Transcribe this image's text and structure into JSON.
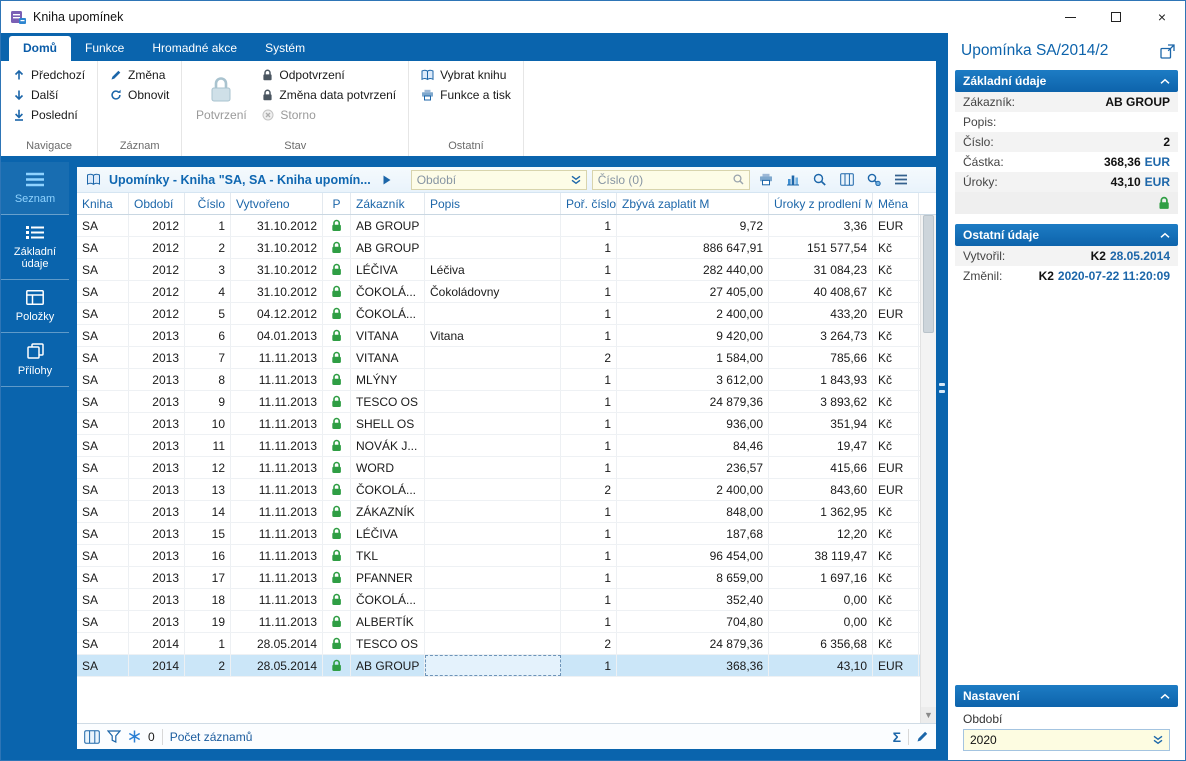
{
  "window": {
    "title": "Kniha upomínek",
    "controls": {
      "minimize": "–",
      "maximize": "",
      "close": "×"
    }
  },
  "tabs": [
    {
      "label": "Domů",
      "active": true
    },
    {
      "label": "Funkce",
      "active": false
    },
    {
      "label": "Hromadné akce",
      "active": false
    },
    {
      "label": "Systém",
      "active": false
    }
  ],
  "ribbon": {
    "navigace": {
      "label": "Navigace",
      "prev": "Předchozí",
      "next": "Další",
      "last": "Poslední"
    },
    "zaznam": {
      "label": "Záznam",
      "change": "Změna",
      "refresh": "Obnovit"
    },
    "stav": {
      "label": "Stav",
      "confirm": "Potvrzení",
      "unconfirm": "Odpotvrzení",
      "change_date": "Změna data potvrzení",
      "cancel": "Storno"
    },
    "ostatni": {
      "label": "Ostatní",
      "select_book": "Vybrat knihu",
      "functions_print": "Funkce a tisk"
    }
  },
  "sidebar": [
    {
      "label": "Seznam",
      "active": true
    },
    {
      "label": "Základní údaje",
      "active": false
    },
    {
      "label": "Položky",
      "active": false
    },
    {
      "label": "Přílohy",
      "active": false
    }
  ],
  "browser": {
    "title": "Upomínky - Kniha \"SA, SA - Kniha upomín...",
    "period_filter": "Období",
    "number_filter": "Číslo (0)",
    "columns": [
      "Kniha",
      "Období",
      "Číslo",
      "Vytvořeno",
      "P",
      "Zákazník",
      "Popis",
      "Poř. číslo",
      "Zbývá zaplatit M",
      "Úroky z prodlení M",
      "Měna"
    ],
    "selected_index": 20,
    "rows": [
      [
        "SA",
        "2012",
        "1",
        "31.10.2012",
        "lock",
        "AB GROUP",
        "",
        "1",
        "9,72",
        "3,36",
        "EUR"
      ],
      [
        "SA",
        "2012",
        "2",
        "31.10.2012",
        "lock",
        "AB GROUP",
        "",
        "1",
        "886 647,91",
        "151 577,54",
        "Kč"
      ],
      [
        "SA",
        "2012",
        "3",
        "31.10.2012",
        "lock",
        "LÉČIVA",
        "Léčiva",
        "1",
        "282 440,00",
        "31 084,23",
        "Kč"
      ],
      [
        "SA",
        "2012",
        "4",
        "31.10.2012",
        "lock",
        "ČOKOLÁ...",
        "Čokoládovny",
        "1",
        "27 405,00",
        "40 408,67",
        "Kč"
      ],
      [
        "SA",
        "2012",
        "5",
        "04.12.2012",
        "lock",
        "ČOKOLÁ...",
        "",
        "1",
        "2 400,00",
        "433,20",
        "EUR"
      ],
      [
        "SA",
        "2013",
        "6",
        "04.01.2013",
        "lock",
        "VITANA",
        "Vitana",
        "1",
        "9 420,00",
        "3 264,73",
        "Kč"
      ],
      [
        "SA",
        "2013",
        "7",
        "11.11.2013",
        "lock",
        "VITANA",
        "",
        "2",
        "1 584,00",
        "785,66",
        "Kč"
      ],
      [
        "SA",
        "2013",
        "8",
        "11.11.2013",
        "lock",
        "MLÝNY",
        "",
        "1",
        "3 612,00",
        "1 843,93",
        "Kč"
      ],
      [
        "SA",
        "2013",
        "9",
        "11.11.2013",
        "lock",
        "TESCO OS",
        "",
        "1",
        "24 879,36",
        "3 893,62",
        "Kč"
      ],
      [
        "SA",
        "2013",
        "10",
        "11.11.2013",
        "lock",
        "SHELL OS",
        "",
        "1",
        "936,00",
        "351,94",
        "Kč"
      ],
      [
        "SA",
        "2013",
        "11",
        "11.11.2013",
        "lock",
        "NOVÁK J...",
        "",
        "1",
        "84,46",
        "19,47",
        "Kč"
      ],
      [
        "SA",
        "2013",
        "12",
        "11.11.2013",
        "lock",
        "WORD",
        "",
        "1",
        "236,57",
        "415,66",
        "EUR"
      ],
      [
        "SA",
        "2013",
        "13",
        "11.11.2013",
        "lock",
        "ČOKOLÁ...",
        "",
        "2",
        "2 400,00",
        "843,60",
        "EUR"
      ],
      [
        "SA",
        "2013",
        "14",
        "11.11.2013",
        "lock",
        "ZÁKAZNÍK",
        "",
        "1",
        "848,00",
        "1 362,95",
        "Kč"
      ],
      [
        "SA",
        "2013",
        "15",
        "11.11.2013",
        "lock",
        "LÉČIVA",
        "",
        "1",
        "187,68",
        "12,20",
        "Kč"
      ],
      [
        "SA",
        "2013",
        "16",
        "11.11.2013",
        "lock",
        "TKL",
        "",
        "1",
        "96 454,00",
        "38 119,47",
        "Kč"
      ],
      [
        "SA",
        "2013",
        "17",
        "11.11.2013",
        "lock",
        "PFANNER",
        "",
        "1",
        "8 659,00",
        "1 697,16",
        "Kč"
      ],
      [
        "SA",
        "2013",
        "18",
        "11.11.2013",
        "lock",
        "ČOKOLÁ...",
        "",
        "1",
        "352,40",
        "0,00",
        "Kč"
      ],
      [
        "SA",
        "2013",
        "19",
        "11.11.2013",
        "lock",
        "ALBERTÍK",
        "",
        "1",
        "704,80",
        "0,00",
        "Kč"
      ],
      [
        "SA",
        "2014",
        "1",
        "28.05.2014",
        "lock",
        "TESCO OS",
        "",
        "2",
        "24 879,36",
        "6 356,68",
        "Kč"
      ],
      [
        "SA",
        "2014",
        "2",
        "28.05.2014",
        "lock",
        "AB GROUP",
        "",
        "1",
        "368,36",
        "43,10",
        "EUR"
      ]
    ],
    "status": {
      "count": "0",
      "records": "Počet záznamů",
      "sum": "Σ"
    }
  },
  "detail": {
    "title": "Upomínka SA/2014/2",
    "basic": {
      "header": "Základní údaje",
      "fields": [
        {
          "label": "Zákazník:",
          "value": "AB GROUP",
          "suffix": ""
        },
        {
          "label": "Popis:",
          "value": "",
          "suffix": ""
        },
        {
          "label": "Číslo:",
          "value": "2",
          "suffix": ""
        },
        {
          "label": "Částka:",
          "value": "368,36",
          "suffix": "EUR"
        },
        {
          "label": "Úroky:",
          "value": "43,10",
          "suffix": "EUR"
        }
      ]
    },
    "other": {
      "header": "Ostatní údaje",
      "fields": [
        {
          "label": "Vytvořil:",
          "value": "K2",
          "suffix": "28.05.2014"
        },
        {
          "label": "Změnil:",
          "value": "K2",
          "suffix": "2020-07-22 11:20:09"
        }
      ]
    },
    "settings": {
      "header": "Nastavení",
      "period_label": "Období",
      "period_value": "2020"
    }
  }
}
